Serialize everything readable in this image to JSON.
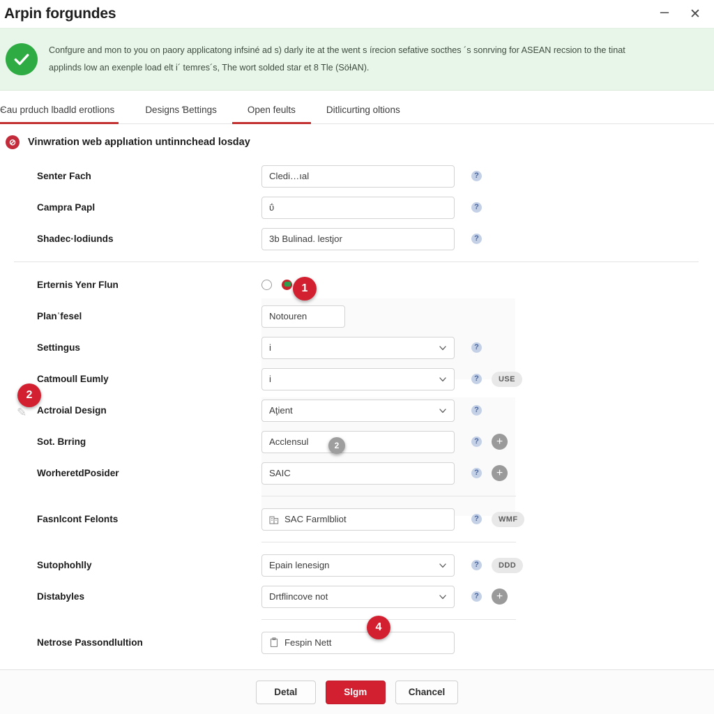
{
  "window": {
    "title": "Arpin forgundes",
    "minimize_label": "–",
    "close_label": "✕"
  },
  "alert": {
    "icon": "check-circle-icon",
    "color": "#2eab43",
    "line1": "Confgure and mon to you on paory applicatong infsiné ad s) darly ite at the went s írecion sefative socthes ´s sonrving for ASEAN recsion to the tinat",
    "line2": "applinds low an exenple load elt i´ temres´s, The wort solded star et 8 Tle (SöƗAN)."
  },
  "tabs": [
    {
      "label": "Єau prduch lbadld erotlions",
      "active": true
    },
    {
      "label": "Designs Ɓettings",
      "active": false
    },
    {
      "label": "Open feults",
      "active": true
    },
    {
      "label": "Ditlicurting oltions",
      "active": false
    }
  ],
  "section": {
    "icon": "error-circle-icon",
    "icon_glyph": "⊘",
    "title": "Vinwration web applıation untinnchead losday"
  },
  "rows": [
    {
      "label": "Senter Fach",
      "control": "text",
      "value": "Cledi…ıal",
      "help": true,
      "extras": []
    },
    {
      "label": "Campra Papl",
      "control": "text",
      "value": "ΰ",
      "help": true,
      "extras": []
    },
    {
      "label": "Shadec·lodiunds",
      "control": "text",
      "value": "3b Bulinad. lestjor",
      "help": true,
      "extras": []
    },
    {
      "label": "Erternis Yenr Flun",
      "control": "radio",
      "options": [
        "option-unselected",
        "option-selected"
      ],
      "selected_index": 1,
      "help": false,
      "extras": []
    },
    {
      "label": "Planˈfesel",
      "control": "text-narrow",
      "value": "Notouren",
      "help": false,
      "extras": []
    },
    {
      "label": "Settingus",
      "control": "select",
      "value": "i",
      "help": true,
      "extras": []
    },
    {
      "label": "Catmoull Eumly",
      "control": "select",
      "value": "i",
      "help": true,
      "extras": [
        {
          "type": "pill",
          "text": "USE"
        }
      ]
    },
    {
      "label": "Actroial Design",
      "control": "select",
      "value": "Aţient",
      "help": true,
      "extras": []
    },
    {
      "label": "Sot. Brring",
      "control": "text",
      "value": "Acclensul",
      "help": true,
      "extras": [
        {
          "type": "plus",
          "text": "+"
        }
      ]
    },
    {
      "label": "WorheretdPosider",
      "control": "text",
      "value": "SAIC",
      "help": true,
      "extras": [
        {
          "type": "plus",
          "text": "+"
        }
      ]
    },
    {
      "label": "Fasnlcont Felonts",
      "control": "text-icon",
      "icon": "building-icon",
      "value": "SAC Farmlbliot",
      "help": true,
      "extras": [
        {
          "type": "pill",
          "text": "WMF"
        }
      ]
    },
    {
      "label": "Sutophohlly",
      "control": "select",
      "value": "Epain lenesign",
      "help": true,
      "extras": [
        {
          "type": "pill",
          "text": "DDD"
        }
      ]
    },
    {
      "label": "Distabyles",
      "control": "select",
      "value": "Drtflincove not",
      "help": true,
      "extras": [
        {
          "type": "plus",
          "text": "+"
        }
      ]
    },
    {
      "label": "Netrose Passondlultion",
      "control": "text-icon",
      "icon": "clipboard-icon",
      "value": "Fespin Nett",
      "help": false,
      "extras": []
    }
  ],
  "markers": [
    {
      "number": "1",
      "style": "red"
    },
    {
      "number": "2",
      "style": "red"
    },
    {
      "number": "2",
      "style": "gray"
    },
    {
      "number": "4",
      "style": "red"
    }
  ],
  "footer": {
    "detail_label": "Detal",
    "submit_label": "Slgm",
    "cancel_label": "Chancel"
  },
  "colors": {
    "accent_red": "#d32030",
    "success_green": "#2eab43",
    "alert_bg": "#e7f6e8"
  },
  "help_glyph": "?"
}
